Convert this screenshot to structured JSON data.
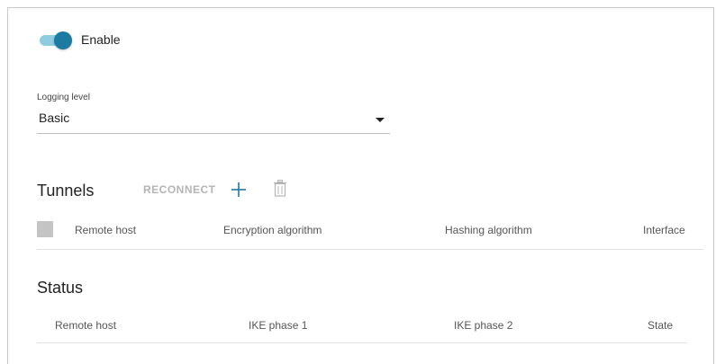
{
  "general": {
    "enable_label": "Enable",
    "enable_state": true
  },
  "logging": {
    "label": "Logging level",
    "value": "Basic"
  },
  "tunnels": {
    "title": "Tunnels",
    "reconnect_label": "RECONNECT",
    "add_icon": "plus-icon",
    "delete_icon": "trash-icon",
    "columns": [
      "Remote host",
      "Encryption algorithm",
      "Hashing algorithm",
      "Interface"
    ]
  },
  "status": {
    "title": "Status",
    "columns": [
      "Remote host",
      "IKE phase 1",
      "IKE phase 2",
      "State"
    ]
  },
  "colors": {
    "accent": "#1b7ba0",
    "accent_light": "#8ecce0",
    "disabled_text": "#b4b4b4",
    "checkbox": "#c4c4c4"
  }
}
